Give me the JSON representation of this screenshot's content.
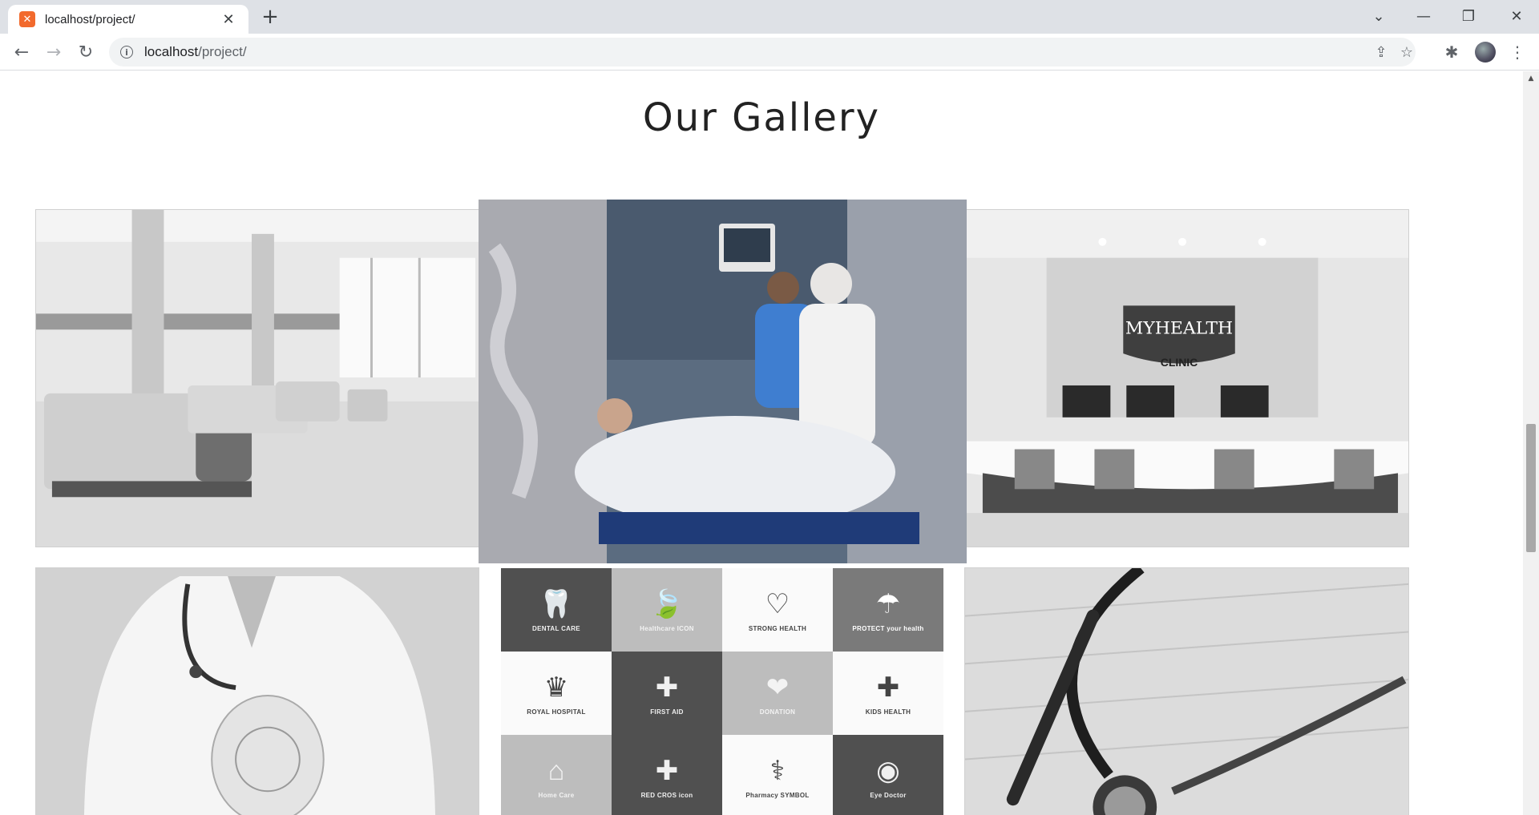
{
  "browser": {
    "tab_title": "localhost/project/",
    "url_host": "localhost",
    "url_path": "/project/"
  },
  "page": {
    "gallery_title": "Our Gallery"
  },
  "gallery": {
    "clinic_sign_line1": "MYHEALTH",
    "clinic_sign_line2": "CLINIC",
    "logos": [
      {
        "caption": "DENTAL CARE",
        "icon": "tooth-icon",
        "glyph": "🦷",
        "tone": "c-dark"
      },
      {
        "caption": "Healthcare ICON",
        "icon": "leaf-cross-icon",
        "glyph": "🍃",
        "tone": "c-mid"
      },
      {
        "caption": "STRONG HEALTH",
        "icon": "heartbeat-icon",
        "glyph": "♡",
        "tone": "c-light"
      },
      {
        "caption": "PROTECT your health",
        "icon": "umbrella-icon",
        "glyph": "☂",
        "tone": "c-gray"
      },
      {
        "caption": "ROYAL HOSPITAL",
        "icon": "crown-icon",
        "glyph": "♛",
        "tone": "c-light"
      },
      {
        "caption": "FIRST AID",
        "icon": "medical-cross-icon",
        "glyph": "✚",
        "tone": "c-dark"
      },
      {
        "caption": "DONATION",
        "icon": "hand-heart-icon",
        "glyph": "❤",
        "tone": "c-mid"
      },
      {
        "caption": "KIDS HEALTH",
        "icon": "kids-cross-icon",
        "glyph": "✚",
        "tone": "c-light"
      },
      {
        "caption": "Home Care",
        "icon": "home-icon",
        "glyph": "⌂",
        "tone": "c-mid"
      },
      {
        "caption": "RED CROS icon",
        "icon": "red-cross-icon",
        "glyph": "✚",
        "tone": "c-dark"
      },
      {
        "caption": "Pharmacy SYMBOL",
        "icon": "caduceus-icon",
        "glyph": "⚕",
        "tone": "c-light"
      },
      {
        "caption": "Eye Doctor",
        "icon": "eye-icon",
        "glyph": "◉",
        "tone": "c-dark"
      }
    ]
  }
}
